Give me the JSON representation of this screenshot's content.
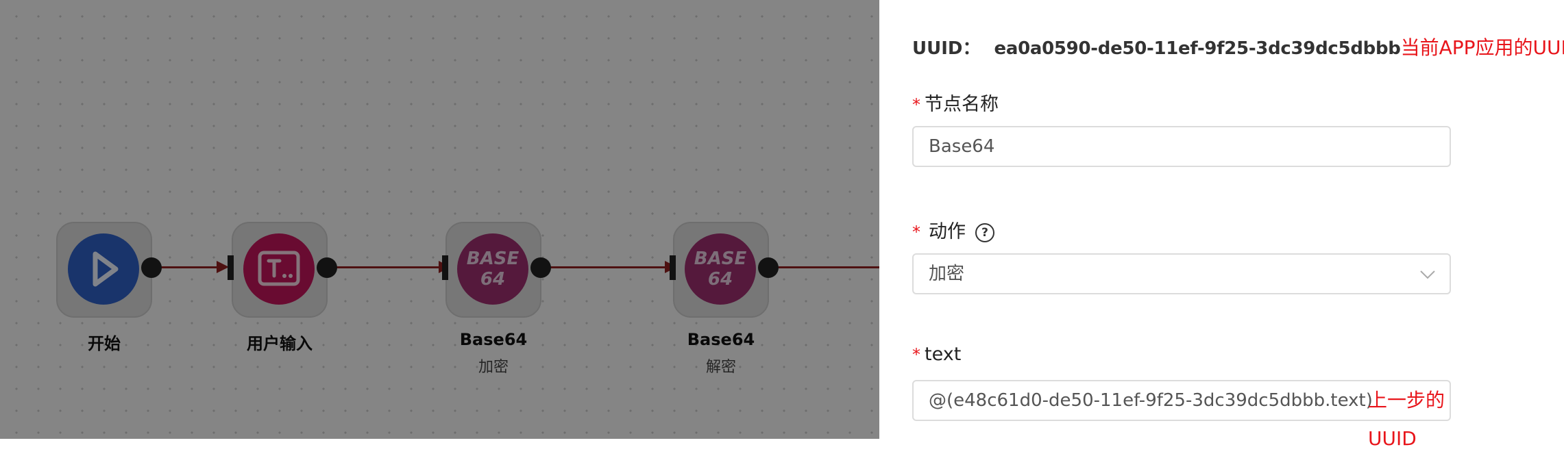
{
  "workflow": {
    "nodes": [
      {
        "title": "开始",
        "subtitle": "",
        "icon": "play-icon",
        "color": "#2f5fc4"
      },
      {
        "title": "用户输入",
        "subtitle": "",
        "icon": "text-input-icon",
        "color": "#c0145a"
      },
      {
        "title": "Base64",
        "subtitle": "加密",
        "icon": "base64-icon",
        "color": "#9c2e6e",
        "icon_text_top": "BASE",
        "icon_text_bottom": "64"
      },
      {
        "title": "Base64",
        "subtitle": "解密",
        "icon": "base64-icon",
        "color": "#9c2e6e",
        "icon_text_top": "BASE",
        "icon_text_bottom": "64"
      }
    ],
    "edge_color": "#8e2020"
  },
  "panel": {
    "uuid_label": "UUID：",
    "uuid_value": "ea0a0590-de50-11ef-9f25-3dc39dc5dbbb",
    "uuid_note": "当前APP应用的UUID",
    "name_field": {
      "label": "节点名称",
      "value": "Base64"
    },
    "action_field": {
      "label": "动作",
      "value": "加密",
      "help_icon": "?"
    },
    "text_field": {
      "label": "text",
      "value": "@(e48c61d0-de50-11ef-9f25-3dc39dc5dbbb.text)",
      "note": "上一步的UUID"
    },
    "required_mark": "*",
    "note_color": "#e8151b"
  }
}
